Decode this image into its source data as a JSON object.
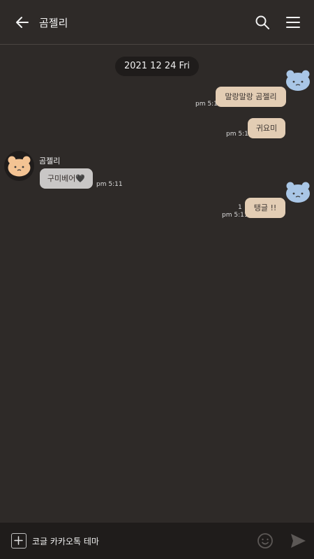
{
  "header": {
    "title": "곰젤리",
    "back_icon": "arrow-left-icon",
    "search_icon": "search-icon",
    "menu_icon": "hamburger-menu-icon"
  },
  "date_divider": "2021 12 24 Fri",
  "messages": [
    {
      "sender": "me",
      "text": "말랑말랑 곰젤리",
      "time": "pm 5:11",
      "unread": ""
    },
    {
      "sender": "me",
      "text": "귀요미",
      "time": "pm 5:11",
      "unread": ""
    },
    {
      "sender": "other",
      "sender_name": "곰젤리",
      "text": "구미베어🖤",
      "time": "pm 5:11",
      "unread": ""
    },
    {
      "sender": "me",
      "text": "탱글 !!",
      "time": "pm 5:11",
      "unread": "1"
    }
  ],
  "input": {
    "value": "코글 카카오톡 테마",
    "plus_icon": "plus-square-icon",
    "emoji_icon": "smiley-icon",
    "send_icon": "send-icon"
  },
  "colors": {
    "background": "#2e2a28",
    "my_bubble": "#e3cdb4",
    "other_bubble": "#c9c7c6",
    "input_bar": "#1f1c1b",
    "blue_bear": "#a9c6e6",
    "orange_bear": "#f3c393"
  }
}
